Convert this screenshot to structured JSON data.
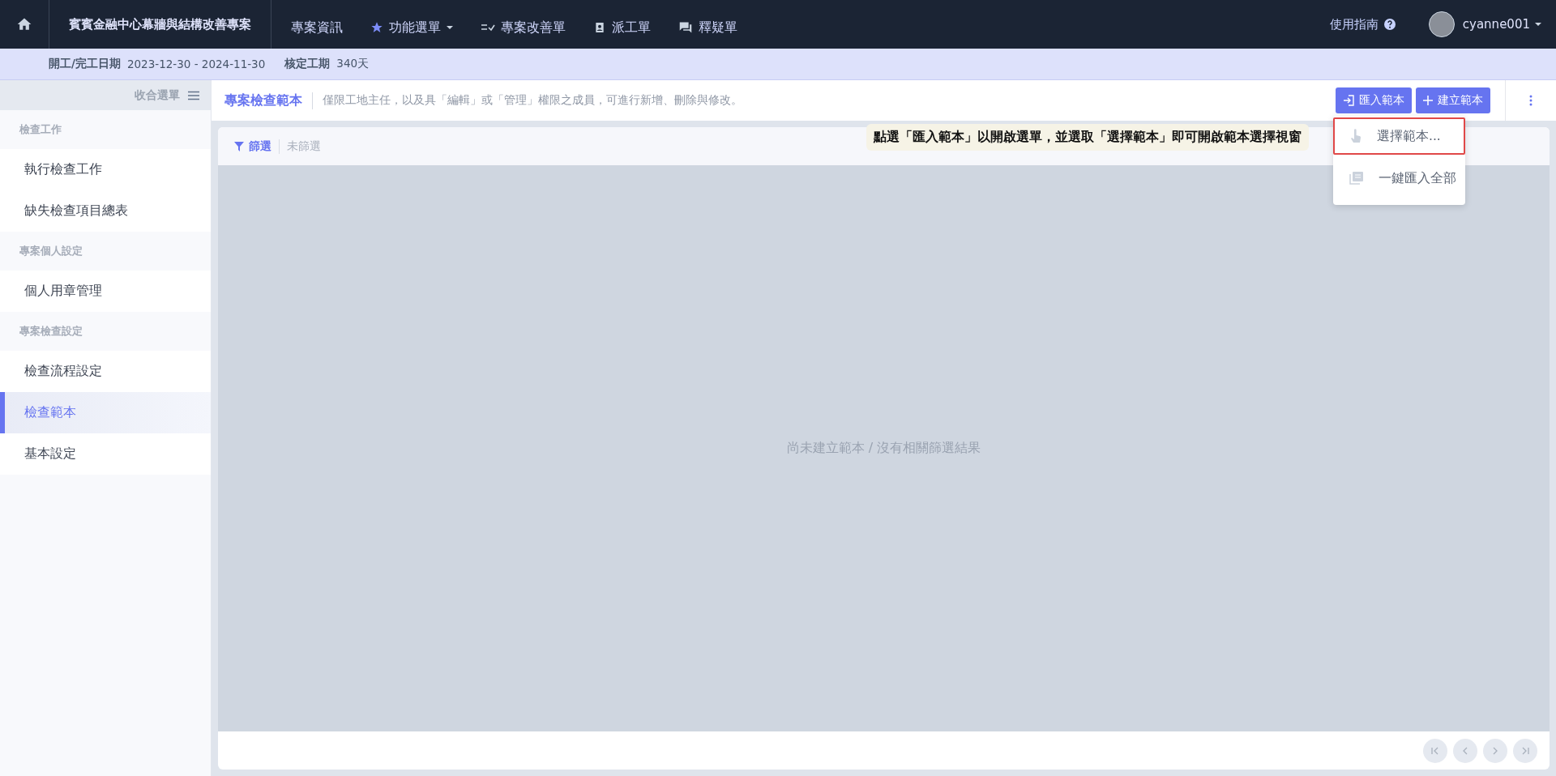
{
  "topbar": {
    "project_title": "賓賓金融中心幕牆與結構改善專案",
    "nav": [
      {
        "label": "專案資訊",
        "kind": "plain"
      },
      {
        "label": "功能選單",
        "kind": "star-menu"
      },
      {
        "label": "專案改善單",
        "kind": "checklist"
      },
      {
        "label": "派工單",
        "kind": "badge"
      },
      {
        "label": "釋疑單",
        "kind": "chat"
      }
    ],
    "guide": "使用指南",
    "user": "cyanne001"
  },
  "info_bar": [
    {
      "label": "開工/完工日期",
      "value": "2023-12-30 - 2024-11-30"
    },
    {
      "label": "核定工期",
      "value": "340天"
    }
  ],
  "sidebar": {
    "collapse_label": "收合選單",
    "sections": [
      {
        "title": "檢查工作",
        "items": [
          {
            "label": "執行檢查工作",
            "selected": false
          },
          {
            "label": "缺失檢查項目總表",
            "selected": false
          }
        ]
      },
      {
        "title": "專案個人設定",
        "items": [
          {
            "label": "個人用章管理",
            "selected": false
          }
        ]
      },
      {
        "title": "專案檢查設定",
        "items": [
          {
            "label": "檢查流程設定",
            "selected": false
          },
          {
            "label": "檢查範本",
            "selected": true
          },
          {
            "label": "基本設定",
            "selected": false
          }
        ]
      }
    ]
  },
  "toolbar": {
    "title": "專案檢查範本",
    "description": "僅限工地主任，以及具「編輯」或「管理」權限之成員，可進行新增、刪除與修改。",
    "buttons": [
      {
        "label": "匯入範本",
        "kind": "import"
      },
      {
        "label": "建立範本",
        "kind": "add"
      }
    ]
  },
  "dropdown": [
    {
      "label": "選擇範本...",
      "kind": "pointer",
      "selected": true
    },
    {
      "label": "一鍵匯入全部",
      "kind": "stack",
      "selected": false
    }
  ],
  "tooltip": "點選「匯入範本」以開啟選單，並選取「選擇範本」即可開啟範本選擇視窗",
  "filter": {
    "label": "篩選",
    "value": "未篩選"
  },
  "empty_message": "尚未建立範本 / 沒有相關篩選結果",
  "pagination": [
    {
      "kind": "first",
      "disabled": true
    },
    {
      "kind": "prev",
      "disabled": true
    },
    {
      "kind": "next",
      "disabled": true
    },
    {
      "kind": "last",
      "disabled": true
    }
  ]
}
